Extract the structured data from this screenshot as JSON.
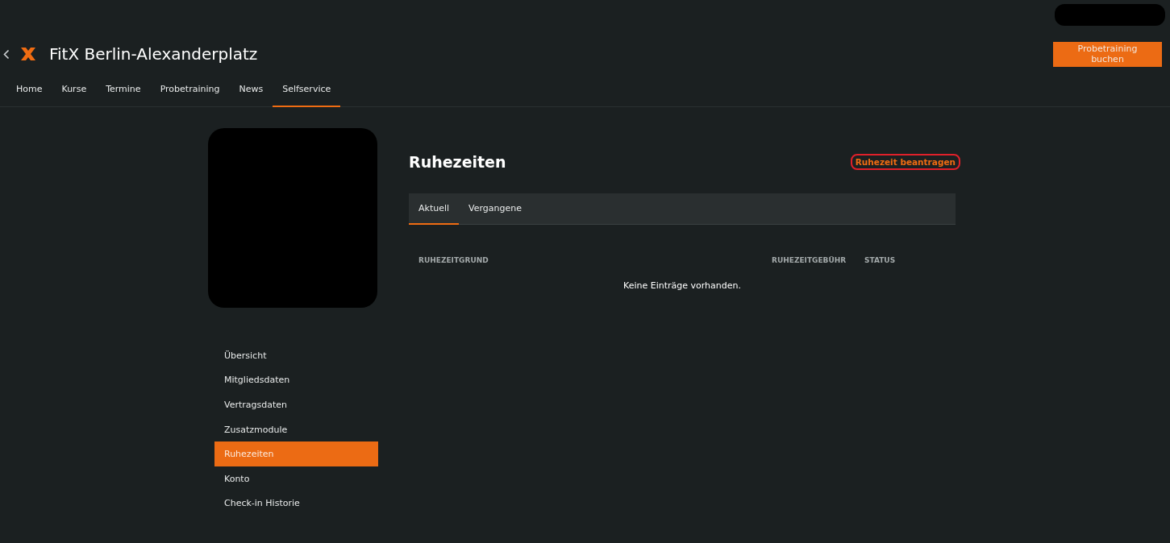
{
  "header": {
    "title": "FitX Berlin-Alexanderplatz",
    "cta": "Probetraining buchen"
  },
  "nav": [
    {
      "label": "Home",
      "selected": false
    },
    {
      "label": "Kurse",
      "selected": false
    },
    {
      "label": "Termine",
      "selected": false
    },
    {
      "label": "Probetraining",
      "selected": false
    },
    {
      "label": "News",
      "selected": false
    },
    {
      "label": "Selfservice",
      "selected": true
    }
  ],
  "sidebar": {
    "items": [
      {
        "label": "Übersicht",
        "selected": false
      },
      {
        "label": "Mitgliedsdaten",
        "selected": false
      },
      {
        "label": "Vertragsdaten",
        "selected": false
      },
      {
        "label": "Zusatzmodule",
        "selected": false
      },
      {
        "label": "Ruhezeiten",
        "selected": true
      },
      {
        "label": "Konto",
        "selected": false
      },
      {
        "label": "Check-in Historie",
        "selected": false
      }
    ]
  },
  "main": {
    "title": "Ruhezeiten",
    "action": {
      "label": "Ruhezeit beantragen",
      "highlighted": true
    },
    "tabs": [
      {
        "label": "Aktuell",
        "selected": true
      },
      {
        "label": "Vergangene",
        "selected": false
      }
    ],
    "table": {
      "columns": [
        "RUHEZEITGRUND",
        "RUHEZEITGEBÜHR",
        "STATUS"
      ],
      "empty": "Keine Einträge vorhanden."
    }
  }
}
